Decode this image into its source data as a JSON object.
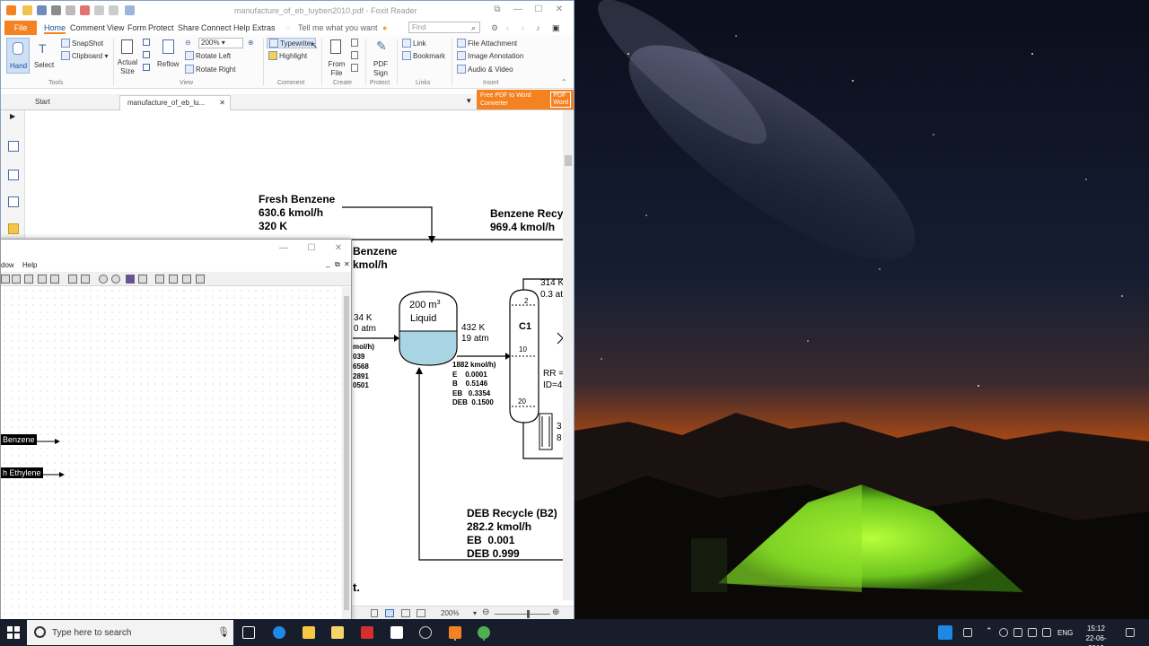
{
  "app": {
    "document_title": "manufacture_of_eb_luyben2010.pdf - Foxit Reader",
    "search_placeholder": "Find",
    "tell_me": "Tell me what you want"
  },
  "menu": [
    "File",
    "Home",
    "Comment",
    "View",
    "Form",
    "Protect",
    "Share",
    "Connect",
    "Help",
    "Extras"
  ],
  "ribbon": {
    "hand": "Hand",
    "select": "Select",
    "snapshot": "SnapShot",
    "clipboard": "Clipboard",
    "actual_size_1": "Actual",
    "actual_size_2": "Size",
    "reflow": "Reflow",
    "zoom": "200%",
    "rotate_left": "Rotate Left",
    "rotate_right": "Rotate Right",
    "typewriter": "Typewriter",
    "highlight": "Highlight",
    "from_file_1": "From",
    "from_file_2": "File",
    "pdf_sign_1": "PDF",
    "pdf_sign_2": "Sign",
    "link": "Link",
    "bookmark": "Bookmark",
    "file_attachment": "File Attachment",
    "image_annotation": "Image Annotation",
    "audio_video": "Audio & Video",
    "groups": {
      "tools": "Tools",
      "view": "View",
      "comment": "Comment",
      "create": "Create",
      "protect": "Protect",
      "links": "Links",
      "insert": "Insert"
    }
  },
  "tabs": {
    "start": "Start",
    "doc": "manufacture_of_eb_lu..."
  },
  "promo": {
    "line1": "Free PDF to Word",
    "line2": "Converter",
    "badge": "PDF\nWord"
  },
  "status": {
    "zoom": "200%"
  },
  "pdf": {
    "fresh_benzene": {
      "name": "Fresh Benzene",
      "flow": "630.6 kmol/h",
      "temp": "320 K"
    },
    "benzene_recycle": {
      "name": "Benzene Recy",
      "flow": "969.4 kmol/h"
    },
    "benzene_partial": {
      "line1": "Benzene",
      "line2": "kmol/h"
    },
    "reactor": {
      "volume": "200 m",
      "sup": "3",
      "phase": "Liquid"
    },
    "reactor_cond": {
      "temp": "432 K",
      "pressure": "19 atm"
    },
    "left_cond": {
      "temp": "34 K",
      "pressure": "0 atm"
    },
    "left_comp": [
      "mol/h)",
      "039",
      "6568",
      "2891",
      "0501"
    ],
    "reactor_out": [
      "1882 kmol/h)",
      "E    0.0001",
      "B    0.5146",
      "EB   0.3354",
      "DEB  0.1500"
    ],
    "column": {
      "name": "C1",
      "tray_top": "2",
      "tray_mid": "10",
      "tray_bot": "20"
    },
    "column_right": {
      "top1": "314 K",
      "top2": "0.3 at",
      "rr": "RR =",
      "id": "ID=4",
      "b1": "3",
      "b2": "8"
    },
    "deb_recycle": {
      "name": "DEB Recycle (B2)",
      "flow": "282.2 kmol/h",
      "eb": "EB  0.001",
      "deb": "DEB 0.999"
    },
    "fragment": "t."
  },
  "drawing": {
    "menu": [
      "dow",
      "Help"
    ],
    "labels": {
      "benzene": "Benzene",
      "ethylene": "h Ethylene"
    }
  },
  "taskbar": {
    "search_placeholder": "Type here to search",
    "lang": "ENG",
    "time": "15:12",
    "date": "22-06-2019"
  },
  "colors": {
    "accent": "#f58220",
    "liquid": "#a8d4e4",
    "taskbar": "#181d2b"
  }
}
